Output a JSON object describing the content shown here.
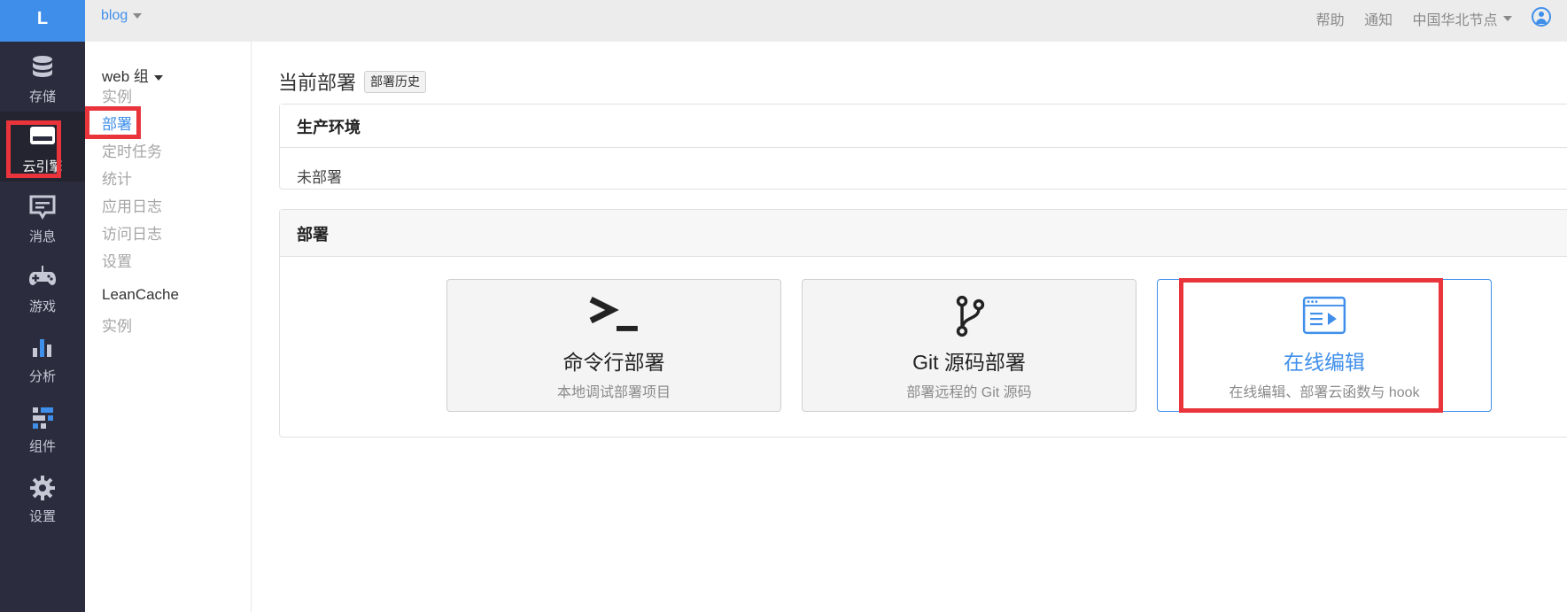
{
  "rail": {
    "logo": "L",
    "items": [
      {
        "label": "存储",
        "icon": "database-icon"
      },
      {
        "label": "云引擎",
        "icon": "cloud-engine-icon"
      },
      {
        "label": "消息",
        "icon": "message-icon"
      },
      {
        "label": "游戏",
        "icon": "gamepad-icon"
      },
      {
        "label": "分析",
        "icon": "bar-chart-icon"
      },
      {
        "label": "组件",
        "icon": "components-icon"
      },
      {
        "label": "设置",
        "icon": "gear-icon"
      }
    ],
    "active_index": 1
  },
  "topbar": {
    "app_name": "blog",
    "help": "帮助",
    "notify": "通知",
    "region": "中国华北节点",
    "avatar_icon": "user-icon"
  },
  "subnav": {
    "group": "web 组",
    "items": [
      "实例",
      "部署",
      "定时任务",
      "统计",
      "应用日志",
      "访问日志",
      "设置"
    ],
    "active_index": 1,
    "section2": "LeanCache",
    "section2_items": [
      "实例"
    ]
  },
  "main": {
    "title": "当前部署",
    "history_button": "部署历史",
    "env_panel": {
      "title": "生产环境",
      "status": "未部署"
    },
    "deploy_panel": {
      "title": "部署",
      "options": [
        {
          "title": "命令行部署",
          "subtitle": "本地调试部署项目",
          "icon": "terminal-icon"
        },
        {
          "title": "Git 源码部署",
          "subtitle": "部署远程的 Git 源码",
          "icon": "git-branch-icon"
        },
        {
          "title": "在线编辑",
          "subtitle": "在线编辑、部署云函数与 hook",
          "icon": "online-editor-icon"
        }
      ],
      "selected_index": 2
    }
  },
  "colors": {
    "accent": "#3f8fea",
    "rail_bg": "#2b2d3e",
    "highlight": "#e8343a"
  }
}
